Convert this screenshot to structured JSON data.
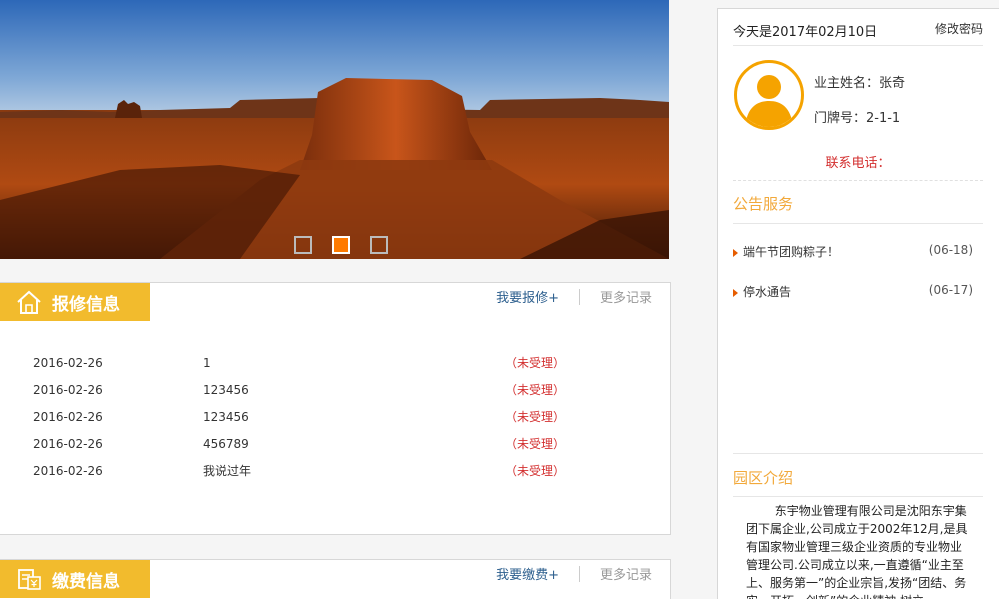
{
  "banner": {
    "slides": [
      {
        "label": "slide-1",
        "active": false
      },
      {
        "label": "slide-2",
        "active": true
      },
      {
        "label": "slide-3",
        "active": false
      }
    ]
  },
  "repair": {
    "title": "报修信息",
    "add_link": "我要报修+",
    "more_link": "更多记录",
    "rows": [
      {
        "date": "2016-02-26",
        "content": "1",
        "status": "（未受理）"
      },
      {
        "date": "2016-02-26",
        "content": "123456",
        "status": "（未受理）"
      },
      {
        "date": "2016-02-26",
        "content": "123456",
        "status": "（未受理）"
      },
      {
        "date": "2016-02-26",
        "content": "456789",
        "status": "（未受理）"
      },
      {
        "date": "2016-02-26",
        "content": "我说过年",
        "status": "（未受理）"
      }
    ]
  },
  "payment": {
    "title": "缴费信息",
    "add_link": "我要缴费+",
    "more_link": "更多记录"
  },
  "sidebar": {
    "today": "今天是2017年02月10日",
    "change_password": "修改密码",
    "owner_name": "业主姓名：张奇",
    "door_no": "门牌号：2-1-1",
    "contact": "联系电话：",
    "notice_title": "公告服务",
    "notices": [
      {
        "text": "端午节团购粽子！",
        "date": "(06-18)"
      },
      {
        "text": "停水通告",
        "date": "(06-17)"
      }
    ],
    "intro_title": "园区介绍",
    "intro_text": "东宇物业管理有限公司是沈阳东宇集团下属企业,公司成立于2002年12月,是具有国家物业管理三级企业资质的专业物业管理公司.公司成立以来,一直遵循“业主至上、服务第一”的企业宗旨,发扬“团结、务实、开拓、创新”的企业精神,树立"
  },
  "colors": {
    "accent_orange": "#f2bb2d",
    "status_red": "#d32f2f",
    "link_blue": "#2d5f8e",
    "active_dot": "#ff7a00"
  }
}
